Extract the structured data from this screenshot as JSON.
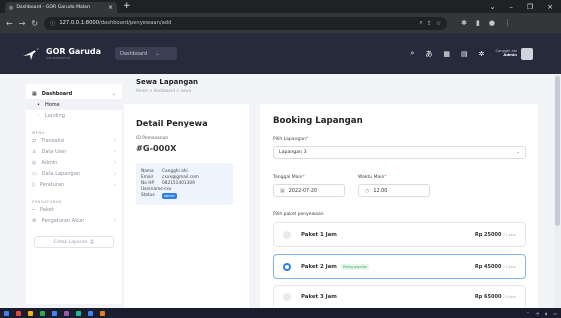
{
  "browser": {
    "tab_title": "Dashboard - GOR Garuda Malan",
    "url_host": "127.0.0.1:8000",
    "url_path": "/dashboard/penyewaan/add"
  },
  "navbar": {
    "brand": "GOR Garuda",
    "brand_sub": "GOR BADMINTON",
    "crumb": "Dashboard",
    "user_name": "Cangghi ahi",
    "user_role": "Admin"
  },
  "sidebar": {
    "dashboard": "Dashboard",
    "home": "Home",
    "landing": "Landing",
    "menu_head": "MENU",
    "transaksi": "Transaksi",
    "data_user": "Data User",
    "admin": "Admin",
    "data_lapangan": "Data Lapangan",
    "peraturan": "Peraturan",
    "setting_head": "PENGATURAN",
    "paket": "Paket",
    "pengaturan_akun": "Pengaturan Akun",
    "cetak": "Cetak Laporan"
  },
  "header": {
    "title": "Sewa Lapangan",
    "breadcrumb": "Home > dashboard > sewa"
  },
  "detail": {
    "title": "Detail Penyewa",
    "id_label": "ID Pemesanan",
    "id_value": "#G-000X",
    "nama_k": "Nama",
    "nama_v": "Cangghi ahi",
    "email_k": "Email",
    "email_v": "cxxx@gmail.com",
    "hp_k": "No HP",
    "hp_v": "082151401309",
    "user_k": "Username",
    "user_v": "cxx",
    "status_k": "Status",
    "status_v": "admin"
  },
  "booking": {
    "title": "Booking Lapangan",
    "pilih_label": "Pilih Lapangan",
    "pilih_value": "Lapangan 3",
    "tanggal_label": "Tanggal Main",
    "tanggal_value": "2022-07-20",
    "waktu_label": "Waktu Main",
    "waktu_value": "12.00",
    "paket_label": "Pilih paket penyewaan",
    "packages": [
      {
        "name": "Paket 1 Jam",
        "price": "Rp 25000",
        "dur": "/ 1 Jam",
        "popular": ""
      },
      {
        "name": "Paket 2 Jam",
        "price": "Rp 45000",
        "dur": "/ 2 Jam",
        "popular": "Paling populer"
      },
      {
        "name": "Paket 3 Jam",
        "price": "Rp 65000",
        "dur": "/ 3 Jam",
        "popular": ""
      }
    ]
  },
  "colors": {
    "nav": "#262a3b",
    "accent": "#2d7fe4",
    "page_bg": "#f3f4f8"
  }
}
